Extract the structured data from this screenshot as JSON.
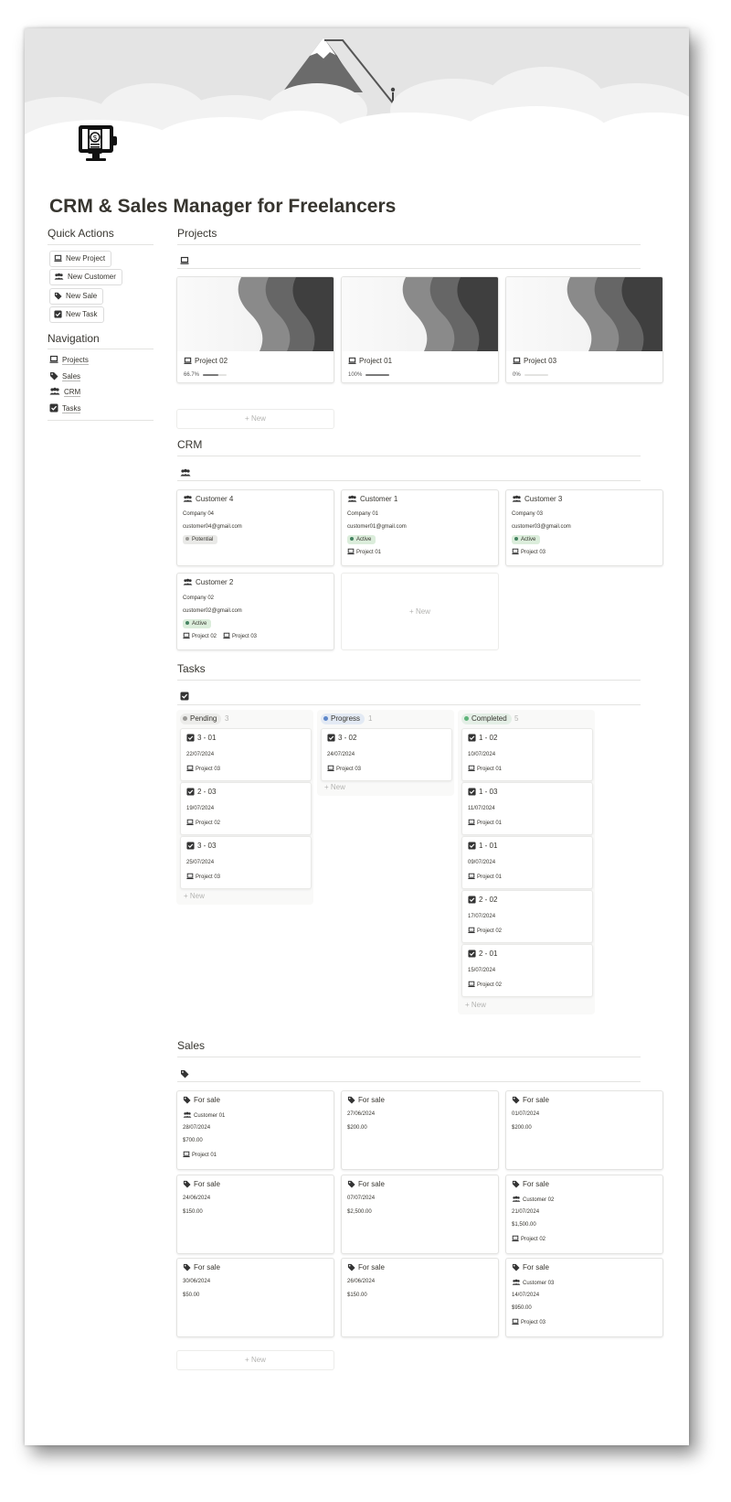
{
  "page": {
    "title": "CRM & Sales Manager for Freelancers"
  },
  "quick_actions": {
    "heading": "Quick Actions",
    "buttons": [
      {
        "label": "New Project",
        "icon": "laptop-icon"
      },
      {
        "label": "New Customer",
        "icon": "people-icon"
      },
      {
        "label": "New Sale",
        "icon": "tag-icon"
      },
      {
        "label": "New Task",
        "icon": "checkbox-icon"
      }
    ]
  },
  "navigation": {
    "heading": "Navigation",
    "items": [
      {
        "label": "Projects",
        "icon": "laptop-icon"
      },
      {
        "label": "Sales",
        "icon": "tag-icon"
      },
      {
        "label": "CRM",
        "icon": "people-icon"
      },
      {
        "label": "Tasks",
        "icon": "checkbox-icon"
      }
    ]
  },
  "projects": {
    "heading": "Projects",
    "new_label": "+ New",
    "cards": [
      {
        "name": "Project 02",
        "progress_label": "66.7%",
        "progress": 0.667
      },
      {
        "name": "Project 01",
        "progress_label": "100%",
        "progress": 1.0
      },
      {
        "name": "Project 03",
        "progress_label": "0%",
        "progress": 0.0
      }
    ]
  },
  "crm": {
    "heading": "CRM",
    "new_label": "+ New",
    "cards": [
      {
        "name": "Customer 4",
        "company": "Company 04",
        "email": "customer04@gmail.com",
        "status": "Potential",
        "projects": []
      },
      {
        "name": "Customer 1",
        "company": "Company 01",
        "email": "customer01@gmail.com",
        "status": "Active",
        "projects": [
          "Project 01"
        ]
      },
      {
        "name": "Customer 3",
        "company": "Company 03",
        "email": "customer03@gmail.com",
        "status": "Active",
        "projects": [
          "Project 03"
        ]
      },
      {
        "name": "Customer 2",
        "company": "Company 02",
        "email": "customer02@gmail.com",
        "status": "Active",
        "projects": [
          "Project 02",
          "Project 03"
        ]
      }
    ]
  },
  "tasks": {
    "heading": "Tasks",
    "new_label": "+ New",
    "columns": [
      {
        "name": "Pending",
        "count": "3",
        "color": "#9b9a97",
        "tasks": [
          {
            "title": "3 - 01",
            "date": "22/07/2024",
            "project": "Project 03"
          },
          {
            "title": "2 - 03",
            "date": "19/07/2024",
            "project": "Project 02"
          },
          {
            "title": "3 - 03",
            "date": "25/07/2024",
            "project": "Project 03"
          }
        ]
      },
      {
        "name": "Progress",
        "count": "1",
        "color": "#5e87c9",
        "tasks": [
          {
            "title": "3 - 02",
            "date": "24/07/2024",
            "project": "Project 03"
          }
        ]
      },
      {
        "name": "Completed",
        "count": "5",
        "color": "#5fb37a",
        "tasks": [
          {
            "title": "1 - 02",
            "date": "10/07/2024",
            "project": "Project 01"
          },
          {
            "title": "1 - 03",
            "date": "11/07/2024",
            "project": "Project 01"
          },
          {
            "title": "1 - 01",
            "date": "09/07/2024",
            "project": "Project 01"
          },
          {
            "title": "2 - 02",
            "date": "17/07/2024",
            "project": "Project 02"
          },
          {
            "title": "2 - 01",
            "date": "15/07/2024",
            "project": "Project 02"
          }
        ]
      }
    ]
  },
  "sales": {
    "heading": "Sales",
    "new_label": "+ New",
    "cards": [
      {
        "title": "For sale",
        "customer": "Customer 01",
        "date": "28/07/2024",
        "amount": "$700.00",
        "project": "Project 01"
      },
      {
        "title": "For sale",
        "date": "27/06/2024",
        "amount": "$200.00"
      },
      {
        "title": "For sale",
        "date": "01/07/2024",
        "amount": "$200.00"
      },
      {
        "title": "For sale",
        "date": "24/06/2024",
        "amount": "$150.00"
      },
      {
        "title": "For sale",
        "date": "07/07/2024",
        "amount": "$2,500.00"
      },
      {
        "title": "For sale",
        "customer": "Customer 02",
        "date": "21/07/2024",
        "amount": "$1,500.00",
        "project": "Project 02"
      },
      {
        "title": "For sale",
        "date": "30/06/2024",
        "amount": "$50.00"
      },
      {
        "title": "For sale",
        "date": "26/06/2024",
        "amount": "$150.00"
      },
      {
        "title": "For sale",
        "customer": "Customer 03",
        "date": "14/07/2024",
        "amount": "$950.00",
        "project": "Project 03"
      }
    ]
  },
  "colors": {
    "active_badge_bg": "#dbeddb",
    "active_dot": "#448361",
    "potential_badge_bg": "#e9e9e7",
    "potential_dot": "#9b9a97"
  }
}
